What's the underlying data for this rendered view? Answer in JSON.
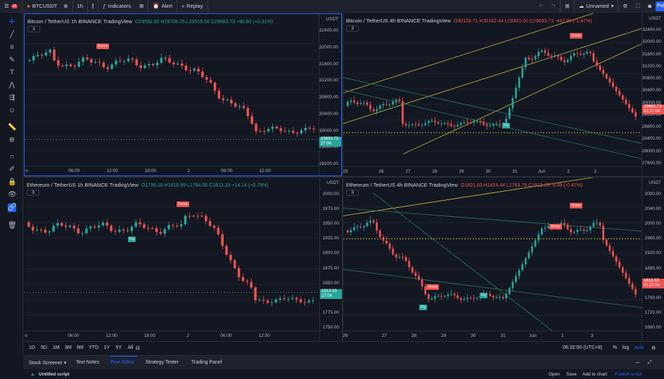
{
  "topbar": {
    "symbol": "BTCUSDT",
    "interval": "1h",
    "indicators": "Indicators",
    "alert": "Alert",
    "replay": "Replay",
    "layout_name": "Unnamed",
    "publish": "Pub",
    "badge": "19"
  },
  "panes": [
    {
      "title": "Bitcoin / TetherUS  1h  BINANCE  TradingView",
      "ohlc": "O29592.92 H29708.26 L29519.58 C29683.73 +90.80 (+0.31%)",
      "ohlc_neg": false,
      "badge": "3",
      "currency": "USDT",
      "price_labels": [
        "32400.00",
        "32000.00",
        "31600.00",
        "31200.00",
        "30800.00",
        "30400.00",
        "30000.00",
        "29600.00",
        "29200.00"
      ],
      "price_tag": [
        "29683.73",
        "27:04"
      ],
      "time_labels": [
        "n",
        "06:00",
        "12:00",
        "18:00",
        "2",
        "06:00",
        "12:00"
      ],
      "flags": [
        {
          "type": "snow",
          "label": "Snow"
        }
      ]
    },
    {
      "title": "Bitcoin / TetherUS  4h  BINANCE  TradingView",
      "ohlc": "O30126.71 H30162.44 L29301.00 C29683.73 -442.99 (-1.47%)",
      "ohlc_neg": true,
      "badge": "3",
      "currency": "USDT",
      "price_labels": [
        "32400.00",
        "32000.00",
        "31600.00",
        "31200.00",
        "30800.00",
        "30400.00",
        "30000.00",
        "29200.00",
        "28800.00",
        "28400.00",
        "28000.00",
        "27600.00"
      ],
      "price_tag": [
        "29683.73",
        "01:27:04"
      ],
      "time_labels": [
        "25",
        "26",
        "27",
        "28",
        "29",
        "30",
        "31",
        "Jun",
        "2",
        "3"
      ],
      "flags": [
        {
          "type": "snow",
          "label": "Snow"
        },
        {
          "type": "fly",
          "label": "Fly"
        }
      ]
    },
    {
      "title": "Ethereum / TetherUS  1h  BINANCE  TradingView",
      "ohlc": "O1799.18 H1816.99 L1794.00 C1813.33 +14.14 (+0.79%)",
      "ohlc_neg": false,
      "badge": "3",
      "currency": "USDT",
      "price_labels": [
        "2000.00",
        "1975.00",
        "1950.00",
        "1925.00",
        "1900.00",
        "1875.00",
        "1850.00",
        "1825.00",
        "1775.00",
        "1750.00"
      ],
      "price_tag": [
        "1813.33",
        "27:04"
      ],
      "time_labels": [
        "n",
        "06:00",
        "12:00",
        "18:00",
        "2",
        "06:00",
        "12:00"
      ],
      "flags": [
        {
          "type": "snow",
          "label": "Snow"
        },
        {
          "type": "fly",
          "label": "Fly"
        }
      ]
    },
    {
      "title": "Ethereum / TetherUS  4h  BINANCE  TradingView",
      "ohlc": "O1821.83 H1824.44 L1763.75 C1813.33 -8.49 (-0.47%)",
      "ohlc_neg": true,
      "badge": "3",
      "currency": "USDT",
      "price_labels": [
        "2080.00",
        "2040.00",
        "2000.00",
        "1960.00",
        "1920.00",
        "1880.00",
        "1840.00",
        "1760.00",
        "1720.00",
        "1680.00"
      ],
      "price_tag": [
        "1813.33",
        "01:27:04"
      ],
      "time_labels": [
        "26",
        "27",
        "28",
        "29",
        "30",
        "31",
        "Jun",
        "2",
        "3"
      ],
      "flags": [
        {
          "type": "snow",
          "label": "Snow"
        },
        {
          "type": "snow",
          "label": "Snow"
        },
        {
          "type": "snow",
          "label": "Snow"
        },
        {
          "type": "fly",
          "label": "Fly"
        },
        {
          "type": "fly",
          "label": "Fly"
        }
      ]
    }
  ],
  "bottom": {
    "ranges": [
      "1D",
      "5D",
      "1M",
      "3M",
      "6M",
      "YTD",
      "1Y",
      "5Y",
      "All"
    ],
    "clock": "06:32:00 (UTC+8)",
    "percent": "%",
    "log": "log",
    "auto": "auto"
  },
  "tabs": [
    "Stock Screener",
    "Text Notes",
    "Pine Editor",
    "Strategy Tester",
    "Trading Panel"
  ],
  "script": {
    "name": "Untitled script",
    "open": "Open",
    "save": "Save",
    "add_to_chart": "Add to chart",
    "publish_script": "Publish script"
  },
  "colors": {
    "up": "#26a69a",
    "down": "#ef5350",
    "channel": "#c8c23a",
    "accent": "#2962ff"
  }
}
